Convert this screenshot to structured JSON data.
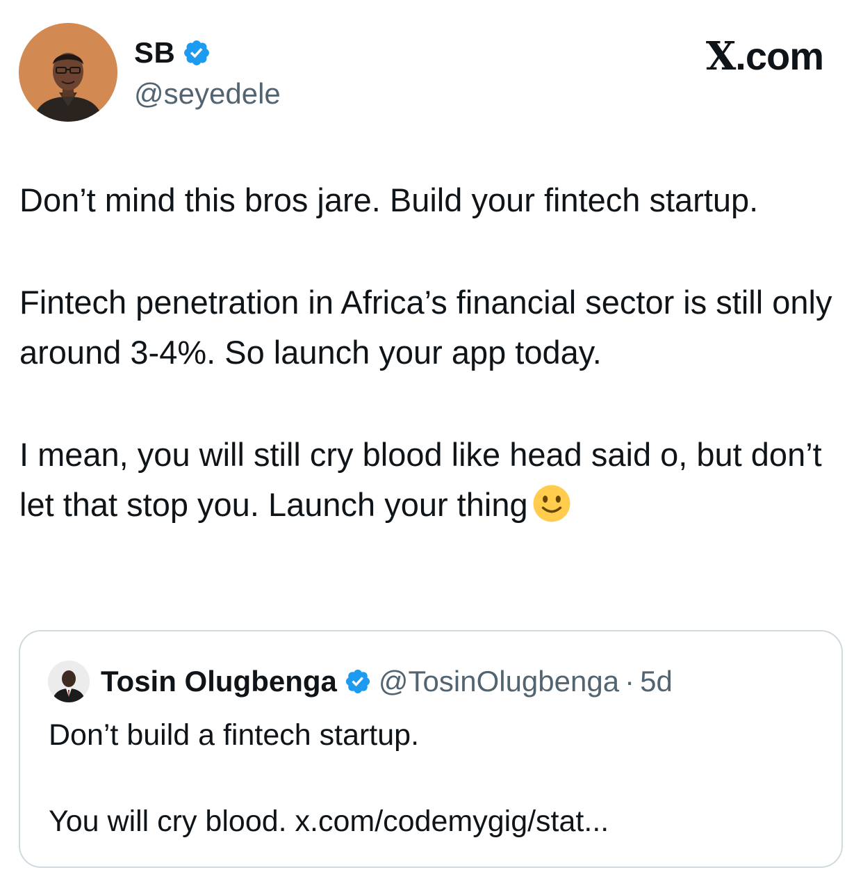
{
  "author": {
    "display_name": "SB",
    "handle": "@seyedele",
    "verified": true
  },
  "brand": {
    "logo_letter": "X",
    "suffix": ".com"
  },
  "tweet": {
    "paragraphs": [
      "Don’t mind this bros jare. Build your fintech startup.",
      "Fintech penetration in Africa’s financial sector is still only around 3-4%. So launch your app today.",
      "I mean, you will still cry blood like head said o, but don’t let that stop you. Launch your thing"
    ],
    "trailing_emoji": "slightly-smiling-face"
  },
  "quoted_tweet": {
    "display_name": "Tosin Olugbenga",
    "verified": true,
    "handle": "@TosinOlugbenga",
    "separator": "·",
    "time": "5d",
    "paragraphs": [
      "Don’t build a fintech startup.",
      "You will cry blood. x.com/codemygig/stat..."
    ]
  },
  "colors": {
    "verified_blue": "#1d9bf0",
    "secondary_text": "#536471",
    "border": "#cfd9de"
  }
}
